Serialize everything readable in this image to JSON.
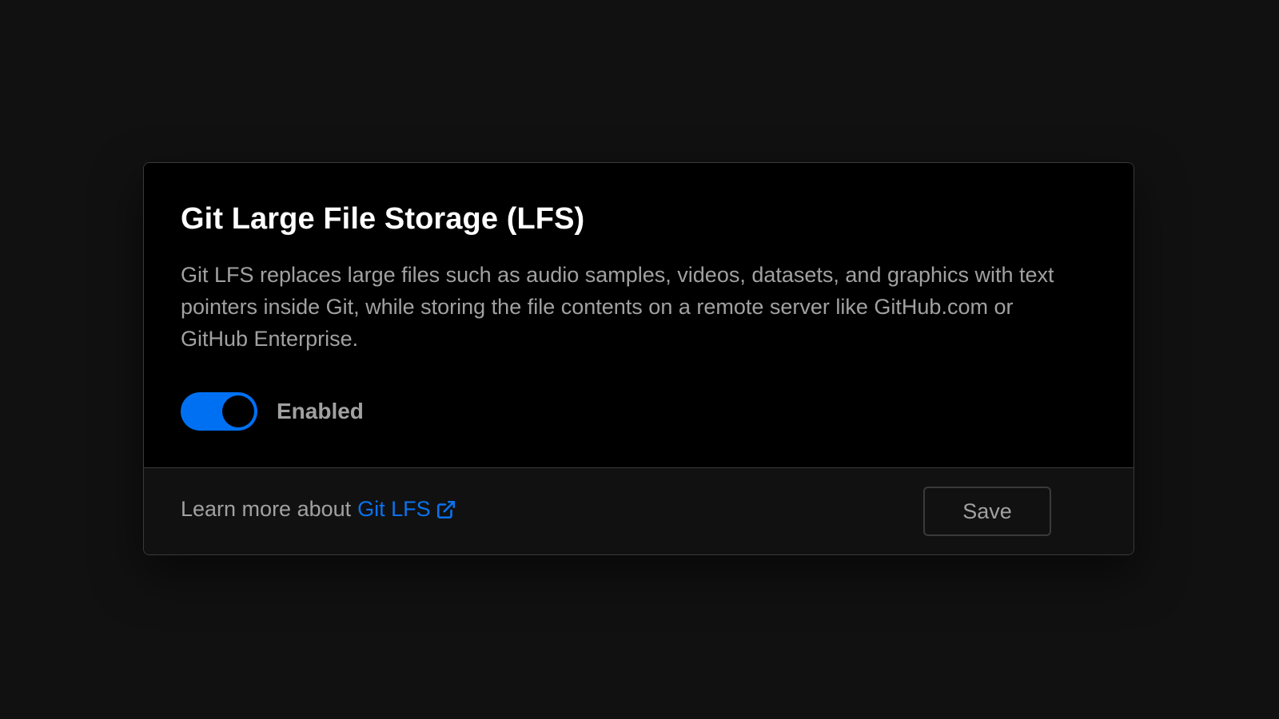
{
  "card": {
    "title": "Git Large File Storage (LFS)",
    "description": "Git LFS replaces large files such as audio samples, videos, datasets, and graphics with text pointers inside Git, while storing the file contents on a remote server like GitHub.com or GitHub Enterprise.",
    "toggle": {
      "label": "Enabled",
      "on": true,
      "accent_color": "#0070f3"
    }
  },
  "footer": {
    "learn_more_prefix": "Learn more about",
    "link_text": "Git LFS",
    "link_icon": "external-link-icon",
    "link_color": "#0a72ef",
    "save_label": "Save"
  }
}
